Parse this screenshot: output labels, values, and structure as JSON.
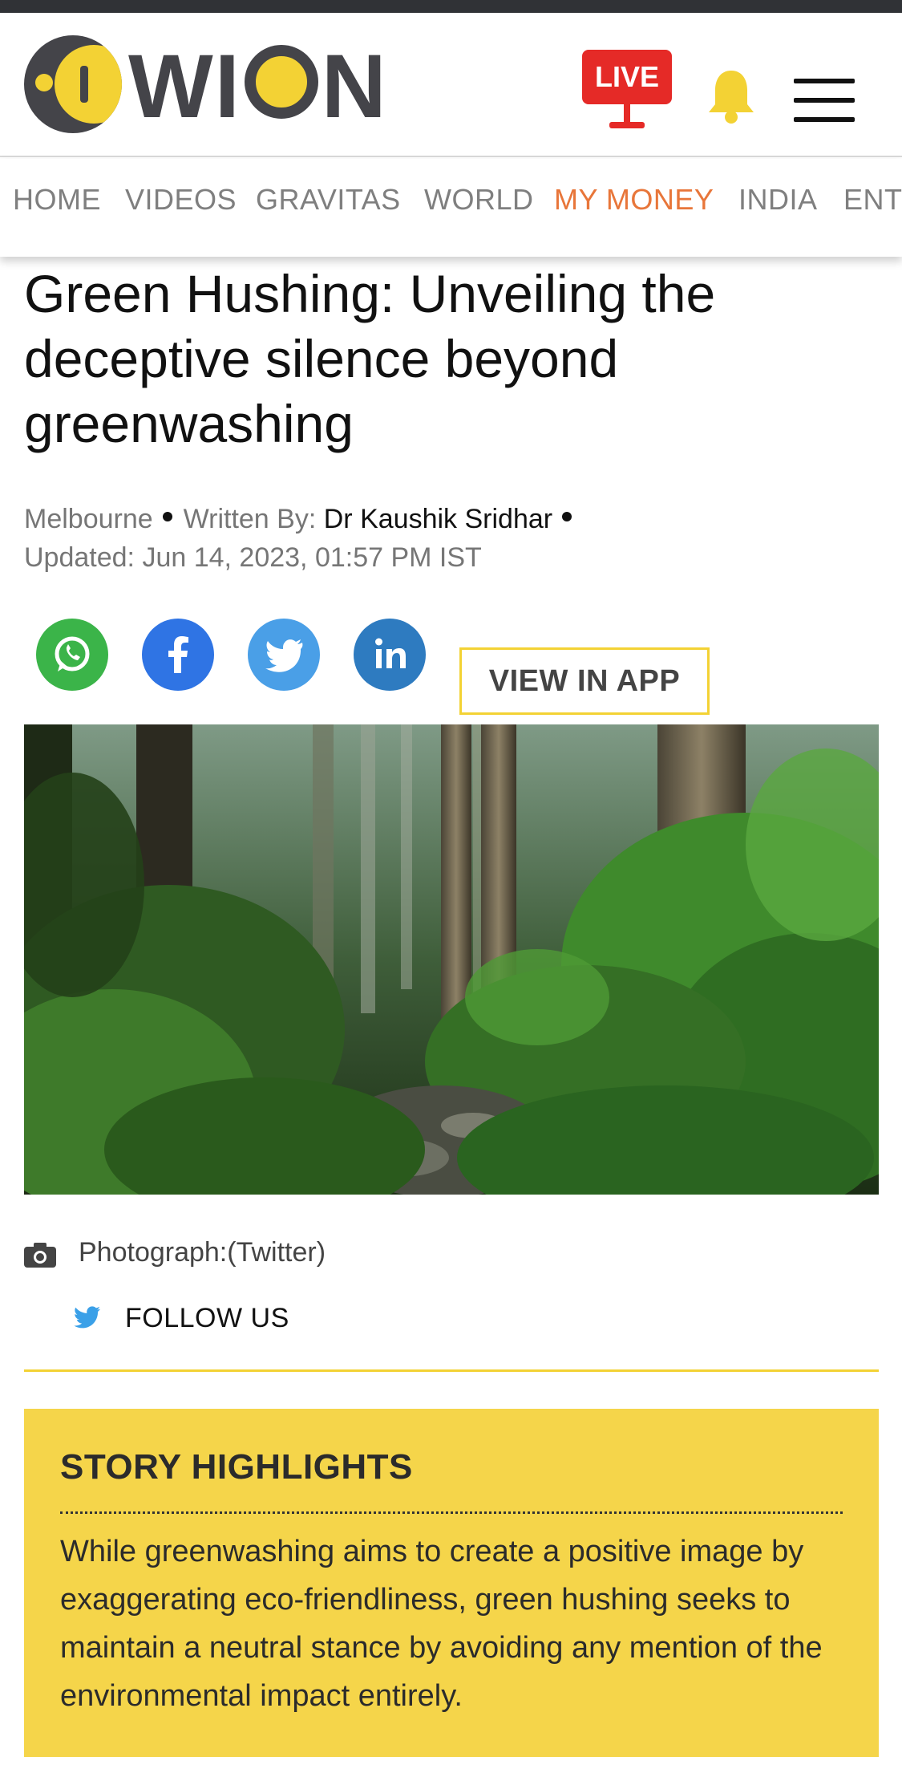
{
  "brand": {
    "logo_text": "WION",
    "accent": "#f3d234",
    "dark": "#444449"
  },
  "header": {
    "live_label": "LIVE",
    "live_color": "#e52a27",
    "notification_icon": "bell-icon",
    "menu_icon": "hamburger-menu-icon"
  },
  "nav": {
    "items": [
      {
        "label": "HOME"
      },
      {
        "label": "VIDEOS"
      },
      {
        "label": "GRAVITAS"
      },
      {
        "label": "WORLD"
      },
      {
        "label": "MY MONEY",
        "active": true
      },
      {
        "label": "INDIA"
      },
      {
        "label": "ENT"
      }
    ],
    "active_color": "#e8763a"
  },
  "article": {
    "title": "Green Hushing: Unveiling the deceptive silence beyond greenwashing",
    "location": "Melbourne",
    "written_by_label": "Written By:",
    "author": "Dr Kaushik Sridhar",
    "updated": "Updated: Jun 14, 2023, 01:57 PM IST",
    "view_in_app": "VIEW IN APP",
    "photo_caption": "Photograph:(Twitter)",
    "follow_label": "FOLLOW US"
  },
  "share": {
    "icons": [
      "whatsapp-icon",
      "facebook-icon",
      "twitter-icon",
      "linkedin-icon"
    ]
  },
  "highlights": {
    "title": "STORY HIGHLIGHTS",
    "text": "While greenwashing aims to create a positive image by exaggerating eco-friendliness, green hushing seeks to maintain a neutral stance by avoiding any mention of the environmental impact entirely."
  }
}
